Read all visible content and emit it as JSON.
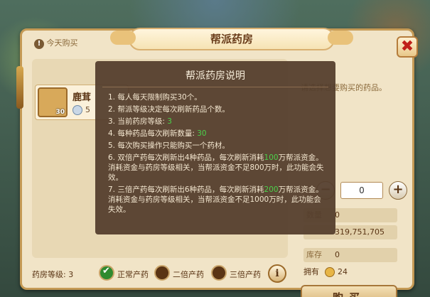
{
  "window": {
    "title": "帮派药房",
    "close_symbol": "✖"
  },
  "notice": {
    "icon": "!",
    "text": "今天购买"
  },
  "item": {
    "name": "鹿茸",
    "qty": "30",
    "price": "5"
  },
  "right": {
    "hint": "请选择想要购买的药品。",
    "qty_minus": "−",
    "qty_value": "0",
    "qty_plus": "+",
    "row1_label": "数量",
    "row1_value": "0",
    "row2_label": "",
    "row2_value": "319,751,705",
    "row3_label": "库存",
    "row3_value": "0",
    "own_label": "拥有",
    "own_value": "24",
    "buy_label": "购买"
  },
  "bottom": {
    "level_label": "药房等级: 3",
    "opt1": "正常产药",
    "opt2": "二倍产药",
    "opt3": "三倍产药",
    "info_symbol": "i"
  },
  "popup": {
    "title": "帮派药房说明",
    "rules": [
      {
        "pre": "1. 每人每天限制购买30个。",
        "hl": "",
        "post": ""
      },
      {
        "pre": "2. 帮派等级决定每次刷新药品个数。",
        "hl": "",
        "post": ""
      },
      {
        "pre": "3. 当前药房等级: ",
        "hl": "3",
        "post": ""
      },
      {
        "pre": "4. 每种药品每次刷新数量: ",
        "hl": "30",
        "post": ""
      },
      {
        "pre": "5. 每次购买操作只能购买一个药材。",
        "hl": "",
        "post": ""
      },
      {
        "pre": "6. 双倍产药每次刷新出4种药品，每次刷新消耗",
        "hl": "100",
        "post": "万帮派资金。消耗资金与药房等级相关，当帮派资金不足800万时，此功能会失效。"
      },
      {
        "pre": "7. 三倍产药每次刷新出6种药品，每次刷新消耗",
        "hl": "200",
        "post": "万帮派资金。消耗资金与药房等级相关，当帮派资金不足1000万时，此功能会失效。"
      }
    ]
  }
}
